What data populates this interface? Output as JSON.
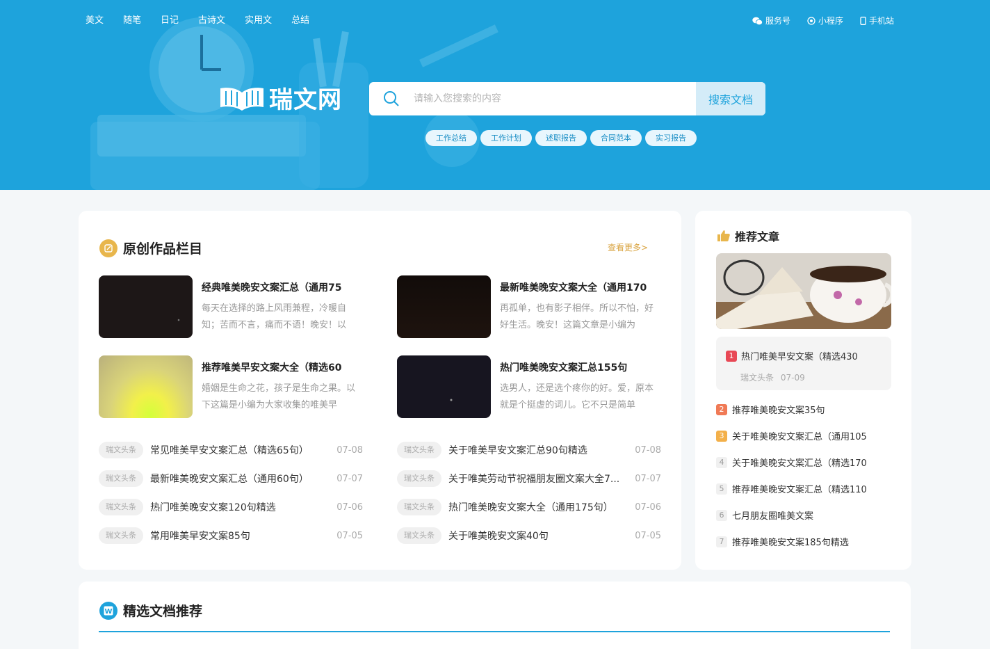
{
  "nav": {
    "items": [
      "美文",
      "随笔",
      "日记",
      "古诗文",
      "实用文",
      "总结"
    ],
    "right": [
      {
        "icon": "wechat-icon",
        "label": "服务号"
      },
      {
        "icon": "miniprogram-icon",
        "label": "小程序"
      },
      {
        "icon": "mobile-icon",
        "label": "手机站"
      }
    ]
  },
  "brand": {
    "name": "瑞文网"
  },
  "search": {
    "placeholder": "请输入您搜索的内容",
    "button": "搜索文档"
  },
  "hot_tags": [
    "工作总结",
    "工作计划",
    "述职报告",
    "合同范本",
    "实习报告"
  ],
  "original": {
    "title": "原创作品栏目",
    "more": "查看更多>",
    "featured": [
      {
        "title": "经典唯美晚安文案汇总（通用75",
        "desc": "每天在选择的路上风雨兼程，冷暖自知；苦而不言，痛而不语！晚安！以"
      },
      {
        "title": "最新唯美晚安文案大全（通用170",
        "desc": "再孤单，也有影子相伴。所以不怕，好好生活。晚安！这篇文章是小编为"
      },
      {
        "title": "推荐唯美早安文案大全（精选60",
        "desc": "婚姻是生命之花，孩子是生命之果。以下这篇是小编为大家收集的唯美早"
      },
      {
        "title": "热门唯美晚安文案汇总155句",
        "desc": "选男人，还是选个疼你的好。爱，原本就是个挺虚的词儿。它不只是简单"
      }
    ],
    "list_left": [
      {
        "source": "瑞文头条",
        "title": "常见唯美早安文案汇总（精选65句）",
        "date": "07-08"
      },
      {
        "source": "瑞文头条",
        "title": "最新唯美晚安文案汇总（通用60句）",
        "date": "07-07"
      },
      {
        "source": "瑞文头条",
        "title": "热门唯美晚安文案120句精选",
        "date": "07-06"
      },
      {
        "source": "瑞文头条",
        "title": "常用唯美早安文案85句",
        "date": "07-05"
      }
    ],
    "list_right": [
      {
        "source": "瑞文头条",
        "title": "关于唯美早安文案汇总90句精选",
        "date": "07-08"
      },
      {
        "source": "瑞文头条",
        "title": "关于唯美劳动节祝福朋友圈文案大全7...",
        "date": "07-07"
      },
      {
        "source": "瑞文头条",
        "title": "热门唯美晚安文案大全（通用175句）",
        "date": "07-06"
      },
      {
        "source": "瑞文头条",
        "title": "关于唯美晚安文案40句",
        "date": "07-05"
      }
    ]
  },
  "recommend": {
    "title": "推荐文章",
    "first": {
      "rank": "1",
      "title": "热门唯美早安文案（精选430",
      "source": "瑞文头条",
      "date": "07-09"
    },
    "items": [
      {
        "rank": "2",
        "title": "推荐唯美晚安文案35句"
      },
      {
        "rank": "3",
        "title": "关于唯美晚安文案汇总（通用105"
      },
      {
        "rank": "4",
        "title": "关于唯美晚安文案汇总（精选170"
      },
      {
        "rank": "5",
        "title": "推荐唯美晚安文案汇总（精选110"
      },
      {
        "rank": "6",
        "title": "七月朋友圈唯美文案"
      },
      {
        "rank": "7",
        "title": "推荐唯美晚安文案185句精选"
      }
    ]
  },
  "selected": {
    "title": "精选文档推荐"
  },
  "colors": {
    "brand": "#1ea3dc",
    "accent": "#d9a441",
    "rank1": "#e84855",
    "rank2": "#f07a56",
    "rank3": "#f3b04a"
  }
}
